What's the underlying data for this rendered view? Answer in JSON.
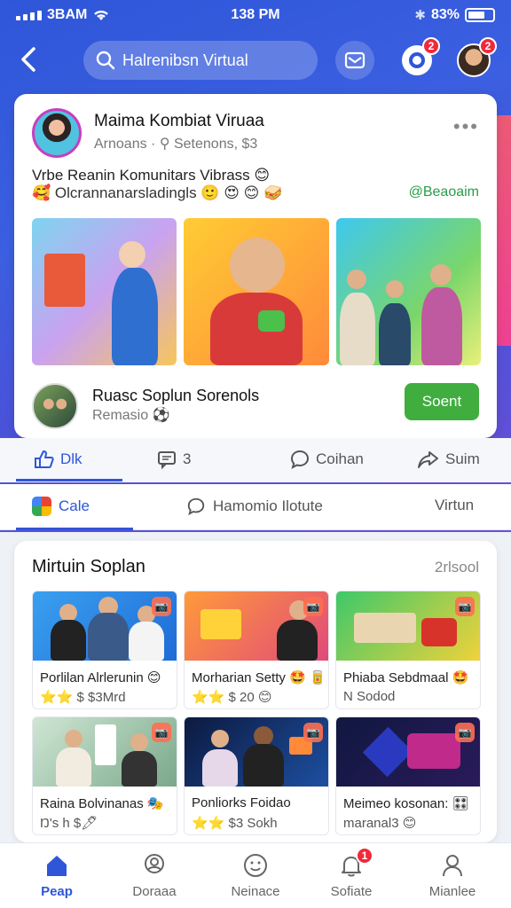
{
  "status": {
    "carrier": "3BAM",
    "time": "138 PM",
    "battery": "83%"
  },
  "header": {
    "search_text": "Halrenibsn Virtual",
    "ring_badge": "2",
    "avatar_badge": "2"
  },
  "post": {
    "author_name": "Maima Kombiat Viruaa",
    "author_sub": "Arnoans · ⚲ Setenons, $3",
    "text_line1": "Vrbe Reanin Komunitars Vibrass 😊",
    "text_line2": "🥰 Olcrannanarsladingls 🙂 😍 😊 🥪",
    "tag": "@Beaoaim",
    "group_name": "Ruasc Soplun Sorenols",
    "group_sub": "Remasio ⚽",
    "join_label": "Soent"
  },
  "actions": {
    "like": "Dlk",
    "comment": "3",
    "chat": "Coihan",
    "share": "Suim"
  },
  "tabs": {
    "tab1": "Cale",
    "tab2": "Hamomio Ilotute",
    "tab3": "Virtun"
  },
  "section": {
    "title": "Mirtuin Soplan",
    "link": "2rlsool",
    "tiles": [
      {
        "line1": "Porlilan Alrlerunin 😊",
        "line2": "⭐⭐ $ $3Mrd",
        "corner": "📷"
      },
      {
        "line1": "Morharian Setty 🤩 🥫",
        "line2": "⭐⭐ $ 20 😊",
        "corner": "📷"
      },
      {
        "line1": "Phiaba Sebdmaal 🤩",
        "line2": "N Sodod",
        "corner": "📷"
      },
      {
        "line1": "Raina Bolvinanas 🎭",
        "line2": "Ŋ's h $🖊",
        "corner": "📷"
      },
      {
        "line1": "Ponliorks Foidao",
        "line2": "⭐⭐ $3 Sokh",
        "corner": "📷"
      },
      {
        "line1": "Meimeo kosonan: 🎛",
        "line2": "maranal3 😊",
        "corner": "📷"
      }
    ]
  },
  "nav": {
    "item1": "Peap",
    "item2": "Doraaa",
    "item3": "Neinace",
    "item4": "Sofiate",
    "item5": "Mianlee",
    "badge": "1"
  },
  "colors": {
    "primary": "#2f56d9",
    "success": "#3fae3f",
    "badge": "#ee2a3b"
  }
}
